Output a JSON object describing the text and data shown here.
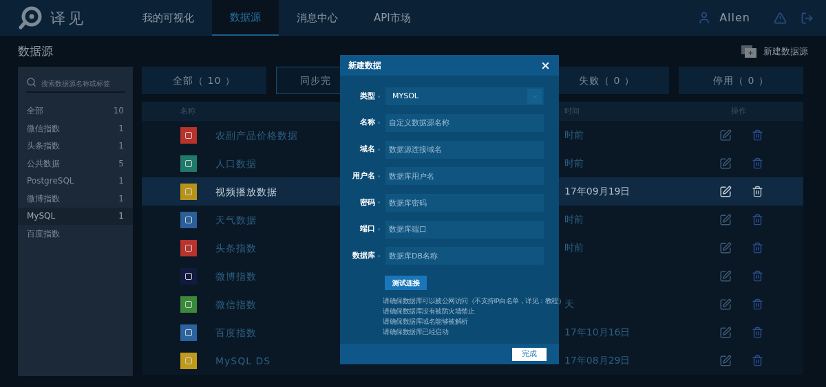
{
  "header": {
    "logo_text": "译见",
    "nav": [
      {
        "label": "我的可视化",
        "selected": false
      },
      {
        "label": "数据源",
        "selected": true
      },
      {
        "label": "消息中心",
        "selected": false
      },
      {
        "label": "API市场",
        "selected": false
      }
    ],
    "user": "Allen"
  },
  "page_title": "数据源",
  "new_button": "新建数据源",
  "sidebar": {
    "search_placeholder": "搜索数据源名称或标签",
    "items": [
      {
        "label": "全部",
        "count": "10",
        "selected": false
      },
      {
        "label": "微信指数",
        "count": "1",
        "selected": false
      },
      {
        "label": "头条指数",
        "count": "1",
        "selected": false
      },
      {
        "label": "公共数据",
        "count": "5",
        "selected": false
      },
      {
        "label": "PostgreSQL",
        "count": "1",
        "selected": false
      },
      {
        "label": "微博指数",
        "count": "1",
        "selected": false
      },
      {
        "label": "MySQL",
        "count": "1",
        "selected": true
      },
      {
        "label": "百度指数",
        "selected": false
      }
    ]
  },
  "tabs": [
    {
      "label": "全部（ 10 ）",
      "selected": false
    },
    {
      "label": "同步完",
      "selected": true
    },
    {
      "label": "失败（ 0 ）",
      "selected": false
    },
    {
      "label": "停用（ 0 ）",
      "selected": false
    }
  ],
  "table": {
    "columns": [
      "名称",
      "时间",
      "操作"
    ],
    "rows": [
      {
        "name": "农副产品价格数据",
        "time": "时前",
        "color": "#b8332b",
        "selected": false
      },
      {
        "name": "人口数据",
        "time": "时前",
        "color": "#1f7a6a",
        "selected": false
      },
      {
        "name": "视频播放数据",
        "time": "17年09月19日",
        "color": "#b8931a",
        "selected": true
      },
      {
        "name": "天气数据",
        "time": "时前",
        "color": "#2a5f99",
        "selected": false
      },
      {
        "name": "头条指数",
        "time": "时前",
        "color": "#b8332b",
        "selected": false
      },
      {
        "name": "微博指数",
        "color": "#121a40",
        "selected": false
      },
      {
        "name": "微信指数",
        "time": "天",
        "color": "#3a8a3a",
        "selected": false
      },
      {
        "name": "百度指数",
        "time": "17年10月16日",
        "color": "#2a64a0",
        "selected": false
      },
      {
        "name": "MySQL DS",
        "time": "17年08月29日",
        "color": "#c09a1a",
        "selected": false
      }
    ]
  },
  "modal": {
    "title": "新建数据",
    "fields": [
      {
        "label": "类型",
        "kind": "select",
        "value": "MYSOL"
      },
      {
        "label": "名称",
        "kind": "text",
        "placeholder": "自定义数据源名称"
      },
      {
        "label": "域名",
        "kind": "text",
        "placeholder": "数据源连接域名"
      },
      {
        "label": "用户名",
        "kind": "text",
        "placeholder": "数据库用户名"
      },
      {
        "label": "密码",
        "kind": "text",
        "placeholder": "数据库密码"
      },
      {
        "label": "端口",
        "kind": "text",
        "placeholder": "数据库端口"
      },
      {
        "label": "数据库",
        "kind": "text",
        "placeholder": "数据库DB名称"
      }
    ],
    "test_button": "测试连接",
    "notes": [
      "请确保数据库可以被公网访问（不支持IP白名单，详见：教程）",
      "请确保数据库没有被防火墙禁止",
      "请确保数据库域名能够被解析",
      "请确保数据库已经启动"
    ],
    "done_button": "完成"
  }
}
